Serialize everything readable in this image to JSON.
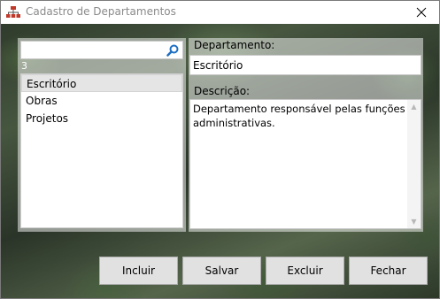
{
  "window": {
    "title": "Cadastro de Departamentos"
  },
  "search": {
    "value": "",
    "placeholder": "",
    "result_count": "3"
  },
  "departments_list": {
    "items": [
      {
        "label": "Escritório",
        "selected": true
      },
      {
        "label": "Obras",
        "selected": false
      },
      {
        "label": "Projetos",
        "selected": false
      }
    ]
  },
  "form": {
    "departamento_label": "Departamento:",
    "departamento_value": "Escritório",
    "descricao_label": "Descrição:",
    "descricao_value": "Departamento responsável pelas funções administrativas."
  },
  "buttons": {
    "incluir": "Incluir",
    "salvar": "Salvar",
    "excluir": "Excluir",
    "fechar": "Fechar"
  },
  "icons": {
    "app": "org-chart-icon",
    "search": "magnifier-icon",
    "close": "close-icon"
  },
  "colors": {
    "search_icon": "#1e6fc2",
    "app_icon": "#c0392b"
  }
}
